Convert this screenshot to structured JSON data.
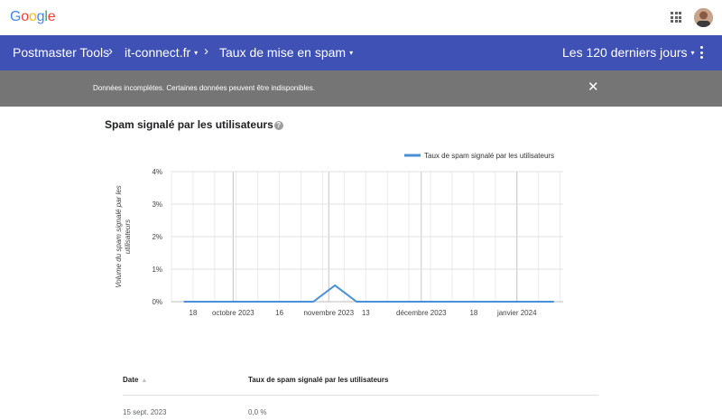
{
  "topbar": {
    "logo_letters": [
      {
        "ch": "G",
        "color": "#4285f4"
      },
      {
        "ch": "o",
        "color": "#ea4335"
      },
      {
        "ch": "o",
        "color": "#fbbc05"
      },
      {
        "ch": "g",
        "color": "#4285f4"
      },
      {
        "ch": "l",
        "color": "#34a853"
      },
      {
        "ch": "e",
        "color": "#ea4335"
      }
    ],
    "apps_icon": "apps-grid-icon",
    "avatar_icon": "account-avatar"
  },
  "navbar": {
    "product": "Postmaster Tools",
    "domain": "it-connect.fr",
    "section": "Taux de mise en spam",
    "period": "Les 120 derniers jours",
    "separator": "›",
    "caret": "▾",
    "bg_color": "#3f51b5"
  },
  "banner": {
    "message": "Données incomplètes. Certaines données peuvent être indisponibles.",
    "close": "✕",
    "bg_color": "#757575"
  },
  "section": {
    "title": "Spam signalé par les utilisateurs",
    "help": "?"
  },
  "chart_data": {
    "type": "line",
    "legend": "Taux de spam signalé par les utilisateurs",
    "legend_position": "top-right",
    "ylabel": "Volume du spam signalé par les utilisateurs",
    "y_ticks": [
      "0%",
      "1%",
      "2%",
      "3%",
      "4%"
    ],
    "ylim": [
      0,
      4
    ],
    "x_ticks": [
      "18",
      "octobre 2023",
      "16",
      "novembre 2023",
      "13",
      "décembre 2023",
      "18",
      "janvier 2024"
    ],
    "x": [
      "2023-09-15",
      "2023-10-27",
      "2023-11-03",
      "2023-11-10",
      "2024-01-13"
    ],
    "series": [
      {
        "values": [
          0,
          0,
          0.5,
          0,
          0
        ]
      }
    ],
    "series_color": "#4a90d9",
    "grid": true
  },
  "table": {
    "col_date": "Date",
    "sort_icon": "▲",
    "col_rate": "Taux de spam signalé par les utilisateurs",
    "rows": [
      {
        "date": "15 sept. 2023",
        "rate": "0,0 %"
      }
    ]
  }
}
